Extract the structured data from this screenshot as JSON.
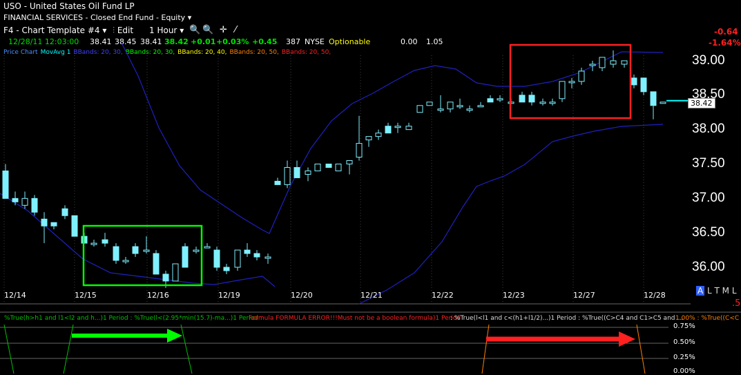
{
  "header": {
    "symbol": "USO",
    "separator": "-",
    "name": "United States Oil Fund LP",
    "category": "FINANCIAL SERVICES - Closed End Fund - Equity"
  },
  "toolbar": {
    "template": "F4 - Chart Template #4",
    "edit": "Edit",
    "interval": "1 Hour"
  },
  "quote": {
    "datetime": "12/28/11 12:03:00",
    "open": "38.41",
    "high": "38.45",
    "low": "38.41",
    "last": "38.42",
    "change": "+0.01",
    "pct_change": "+0.03%",
    "pct_change_color": "#00c000",
    "change2": "+0.45",
    "volume": "387",
    "exchange": "NYSE",
    "optionable": "Optionable",
    "bid_ask": "0.00",
    "beta": "1.05",
    "day_change": "-0.64",
    "day_pct": "-1.64%"
  },
  "indicators": [
    {
      "label": "Price Chart",
      "color": "#4a90ff"
    },
    {
      "label": "MovAvg 1",
      "color": "#00ffff"
    },
    {
      "label": "BBands: 20, 30,",
      "color": "#4040ff"
    },
    {
      "label": "BBands: 20, 30,",
      "color": "#00ff00"
    },
    {
      "label": "BBands: 20, 40,",
      "color": "#ffff00"
    },
    {
      "label": "BBands: 20, 50,",
      "color": "#ff8000"
    },
    {
      "label": "BBands: 20, 50,",
      "color": "#ff2020"
    }
  ],
  "y_axis": [
    "39.00",
    "38.50",
    "38.00",
    "37.50",
    "37.00",
    "36.50",
    "36.00"
  ],
  "x_axis": [
    "12/14",
    "12/15",
    "12/16",
    "12/19",
    "12/20",
    "12/21",
    "12/22",
    "12/23",
    "12/27",
    "12/28"
  ],
  "last_price_label": "38.42",
  "alt_label": "A",
  "tml_label": "L T M L",
  "right_edge": ".5",
  "lower_panel": {
    "row1": "%True(h>h1 and l1<l2 and h...)1 Period : %True(l<(2.95*min(15.7)-ma...)1 Period :",
    "row1_error": "Formula FORMULA ERROR!!!Must not be a boolean formula)1 Period",
    "row1_tail": ": %True(l<l1 and c<(h1+l1/2)...)1 Period : %True((C>C4 and C1>C5 and ...",
    "row1_end": "1.00% : %True((C<C",
    "pct_labels": [
      "0.75%",
      "0.50%",
      "0.25%",
      "0.00%"
    ]
  },
  "colors": {
    "candle": "#7ff0ff",
    "bband": "#2020c0",
    "green_box": "#00ff00",
    "red_box": "#ff2020",
    "positive": "#00e000",
    "negative": "#ff2020"
  }
}
